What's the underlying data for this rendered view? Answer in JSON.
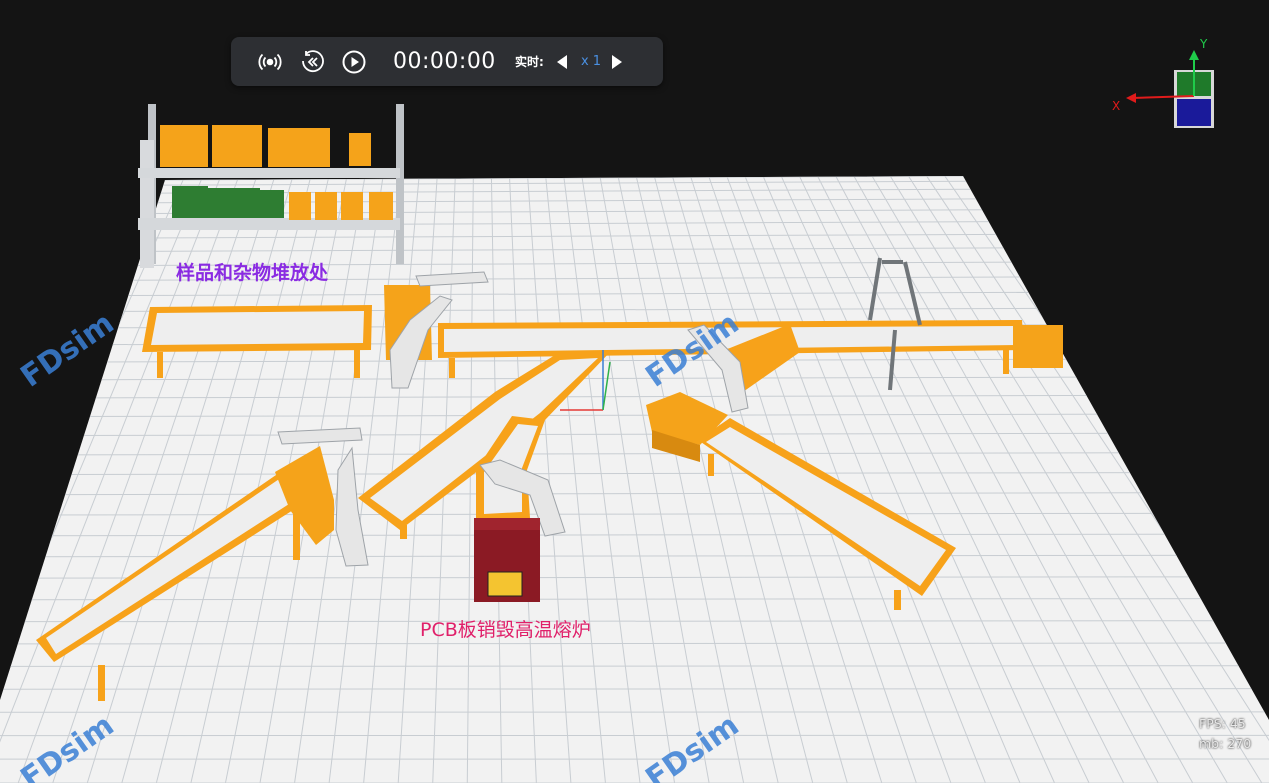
{
  "toolbar": {
    "live_icon": "broadcast-icon",
    "rewind_icon": "rewind-icon",
    "play_icon": "play-icon",
    "time": "00:00:00",
    "realtime_label": "实时:",
    "prev_speed_icon": "triangle-left-icon",
    "next_speed_icon": "triangle-right-icon",
    "speed": "x 1"
  },
  "gizmo": {
    "y_label": "Y",
    "x_label": "X",
    "colors": {
      "x": "#e01b1b",
      "y": "#1fcc4a",
      "top_face": "#1f7a2a",
      "front_face": "#1a1a9a"
    }
  },
  "scene": {
    "labels": {
      "storage_area": "样品和杂物堆放处",
      "furnace": "PCB板销毁高温熔炉"
    },
    "watermark": "FDsim",
    "colors": {
      "floor": "#f2f2f2",
      "grid": "#c8cdd2",
      "conveyor_frame": "#f7a21a",
      "conveyor_belt": "#eeeeee",
      "bin": "#f5a31a",
      "furnace": "#8b1a24",
      "storage_label": "#8a2be2",
      "furnace_label": "#e0206a",
      "watermark": "#3a7fd5"
    }
  },
  "stats": {
    "fps_label": "FPS:",
    "fps_value": "45",
    "mb_label": "mb:",
    "mb_value": "270"
  }
}
